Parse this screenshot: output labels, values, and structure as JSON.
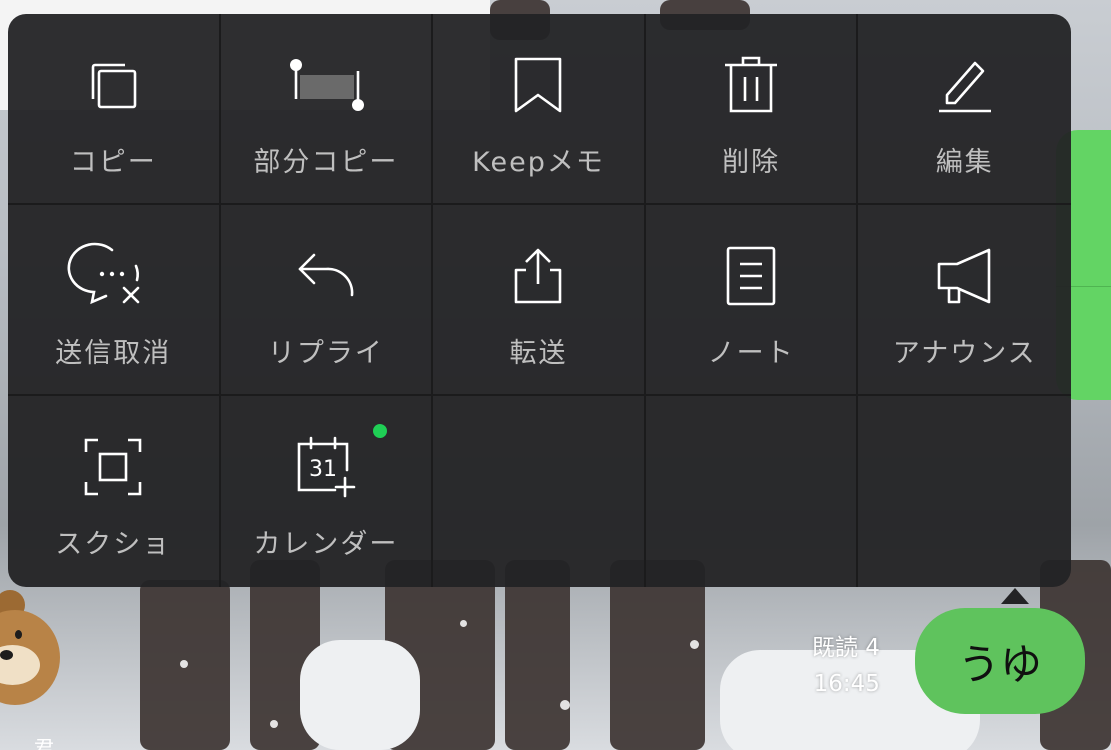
{
  "menu": {
    "items": [
      {
        "label": "コピー",
        "icon": "copy-icon"
      },
      {
        "label": "部分コピー",
        "icon": "partial-copy-icon"
      },
      {
        "label": "Keepメモ",
        "icon": "bookmark-icon"
      },
      {
        "label": "削除",
        "icon": "trash-icon"
      },
      {
        "label": "編集",
        "icon": "pencil-icon"
      },
      {
        "label": "送信取消",
        "icon": "unsend-icon"
      },
      {
        "label": "リプライ",
        "icon": "reply-icon"
      },
      {
        "label": "転送",
        "icon": "share-icon"
      },
      {
        "label": "ノート",
        "icon": "note-icon"
      },
      {
        "label": "アナウンス",
        "icon": "megaphone-icon"
      },
      {
        "label": "スクショ",
        "icon": "screenshot-icon"
      },
      {
        "label": "カレンダー",
        "icon": "calendar-plus-icon",
        "badge": "new-dot"
      }
    ],
    "calendar_day": "31",
    "badge_color": "#1fcf55"
  },
  "message": {
    "text": "うゆ",
    "read_status": "既読 4",
    "time": "16:45",
    "bubble_color": "#5fc35d"
  },
  "background": {
    "glyph": "君"
  }
}
